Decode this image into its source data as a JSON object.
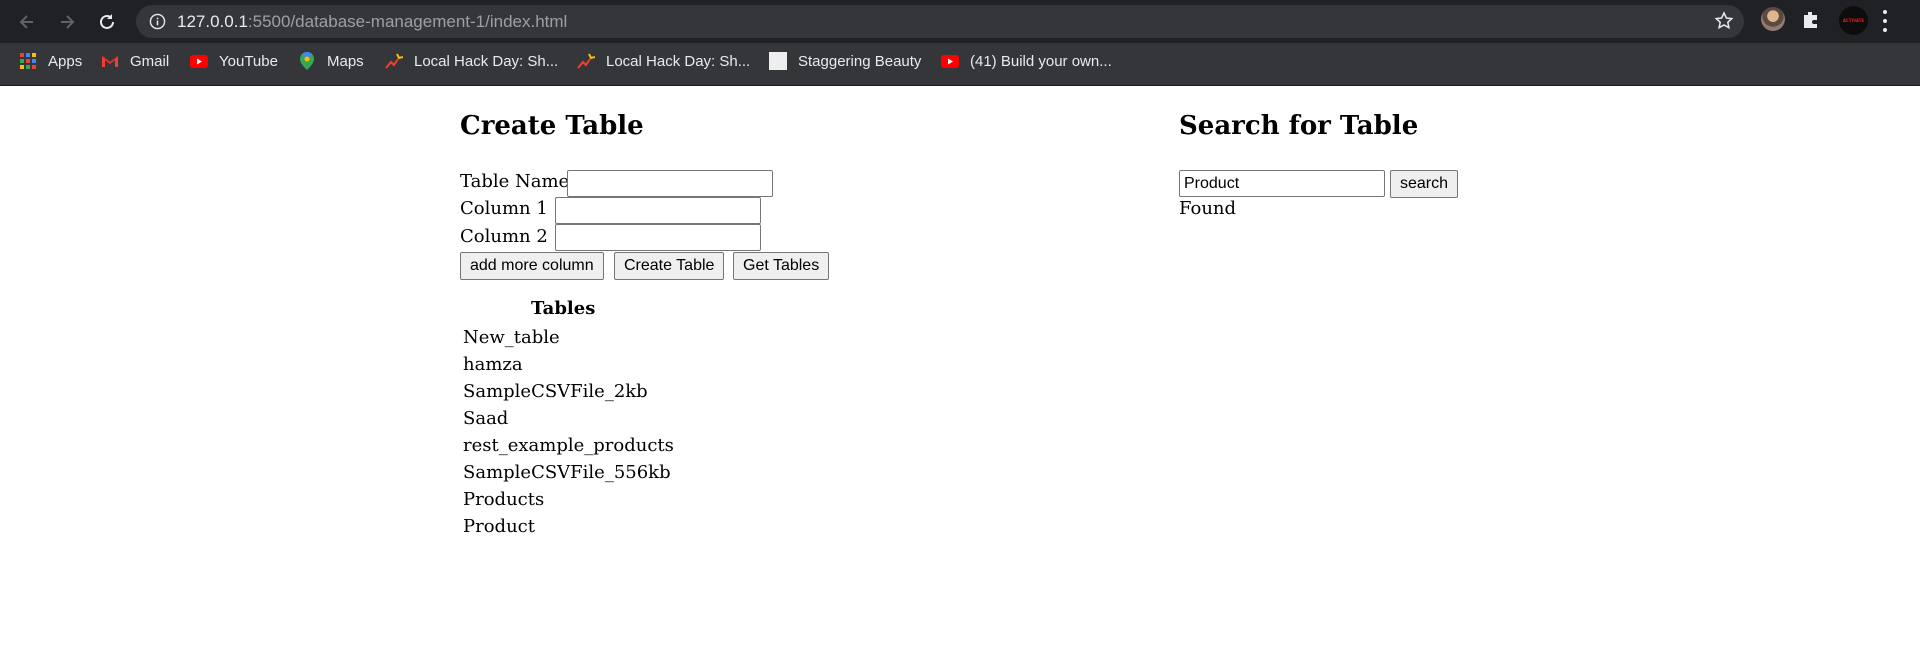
{
  "browser": {
    "url_host": "127.0.0.1",
    "url_rest": ":5500/database-management-1/index.html",
    "avatar_text": "ACTIVATE",
    "bookmarks": [
      {
        "label": "Apps",
        "icon": "apps-grid-icon"
      },
      {
        "label": "Gmail",
        "icon": "gmail-icon"
      },
      {
        "label": "YouTube",
        "icon": "youtube-icon"
      },
      {
        "label": "Maps",
        "icon": "maps-icon"
      },
      {
        "label": "Local Hack Day: Sh...",
        "icon": "hackday-icon"
      },
      {
        "label": "Local Hack Day: Sh...",
        "icon": "hackday-icon"
      },
      {
        "label": "Staggering Beauty",
        "icon": "blank-page-icon"
      },
      {
        "label": "(41) Build your own...",
        "icon": "youtube-icon"
      }
    ]
  },
  "create": {
    "title": "Create Table",
    "table_name_label": "Table Name:",
    "table_name_value": "",
    "column1_label": "Column 1 :",
    "column1_value": "",
    "column2_label": "Column 2 :",
    "column2_value": "",
    "add_column_button": "add more column",
    "create_button": "Create Table",
    "get_tables_button": "Get Tables",
    "tables_heading": "Tables",
    "tables": [
      "New_table",
      "hamza",
      "SampleCSVFile_2kb",
      "Saad",
      "rest_example_products",
      "SampleCSVFile_556kb",
      "Products",
      "Product"
    ]
  },
  "search": {
    "title": "Search for Table",
    "query_value": "Product",
    "search_button": "search",
    "result_text": "Found"
  }
}
